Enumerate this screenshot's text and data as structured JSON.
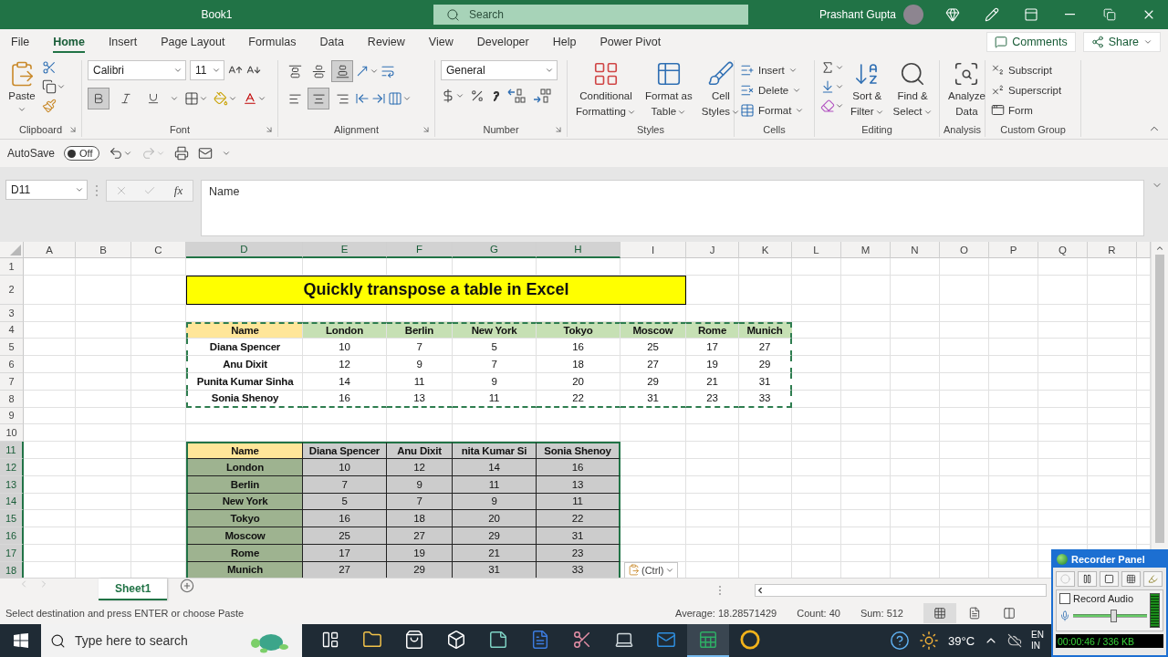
{
  "title_bar": {
    "title": "Book1",
    "search_placeholder": "Search",
    "user_name": "Prashant Gupta"
  },
  "ribbon_tabs": [
    {
      "label": "File",
      "selected": false
    },
    {
      "label": "Home",
      "selected": true
    },
    {
      "label": "Insert",
      "selected": false
    },
    {
      "label": "Page Layout",
      "selected": false
    },
    {
      "label": "Formulas",
      "selected": false
    },
    {
      "label": "Data",
      "selected": false
    },
    {
      "label": "Review",
      "selected": false
    },
    {
      "label": "View",
      "selected": false
    },
    {
      "label": "Developer",
      "selected": false
    },
    {
      "label": "Help",
      "selected": false
    },
    {
      "label": "Power Pivot",
      "selected": false
    }
  ],
  "comments_button": "Comments",
  "share_button": "Share",
  "ribbon_groups": [
    {
      "kind": "clipboard",
      "label": "Clipboard",
      "paste_label": "Paste"
    },
    {
      "kind": "font",
      "label": "Font",
      "font_name": "Calibri",
      "font_size": "11",
      "bold_on": true,
      "italic_on": false,
      "underline_on": false
    },
    {
      "kind": "alignment",
      "label": "Alignment",
      "vertical_buttons": [
        {
          "selected": false
        },
        {
          "selected": false
        },
        {
          "selected": true
        }
      ],
      "horizontal_buttons": [
        {
          "selected": false
        },
        {
          "selected": true
        },
        {
          "selected": false
        }
      ]
    },
    {
      "kind": "number",
      "label": "Number",
      "format": "General"
    },
    {
      "kind": "styles",
      "label": "Styles",
      "buttons": [
        {
          "lines": [
            "Conditional",
            "Formatting"
          ],
          "dropdown": true
        },
        {
          "lines": [
            "Format as",
            "Table"
          ],
          "dropdown": true
        },
        {
          "lines": [
            "Cell",
            "Styles"
          ],
          "dropdown": true
        }
      ]
    },
    {
      "kind": "cells",
      "label": "Cells",
      "buttons": [
        "Insert",
        "Delete",
        "Format"
      ]
    },
    {
      "kind": "editing",
      "label": "Editing",
      "buttons": [
        {
          "lines": [
            "Sort &",
            "Filter"
          ],
          "dropdown": true
        },
        {
          "lines": [
            "Find &",
            "Select"
          ],
          "dropdown": true
        }
      ]
    },
    {
      "kind": "analysis",
      "label": "Analysis",
      "buttons": [
        {
          "lines": [
            "Analyze",
            "Data"
          ],
          "dropdown": false
        }
      ]
    },
    {
      "kind": "custom",
      "label": "Custom Group",
      "buttons": [
        "Subscript",
        "Superscript",
        "Form"
      ]
    }
  ],
  "quick_access": {
    "autosave_label": "AutoSave",
    "autosave_on": false,
    "autosave_state": "Off"
  },
  "formula_bar": {
    "name_box": "D11",
    "function_label": "fx",
    "formula": "Name"
  },
  "sheet": {
    "columns": [
      "A",
      "B",
      "C",
      "D",
      "E",
      "F",
      "G",
      "H",
      "I",
      "J",
      "K",
      "L",
      "M",
      "N",
      "O",
      "P",
      "Q",
      "R"
    ],
    "rows": [
      "1",
      "2",
      "3",
      "4",
      "5",
      "6",
      "7",
      "8",
      "9",
      "10",
      "11",
      "12",
      "13",
      "14",
      "15",
      "16",
      "17",
      "18"
    ],
    "title_cell": {
      "text": "Quickly transpose a table in Excel"
    },
    "tables": [
      {
        "copy_marquee": true,
        "selected": false,
        "header": [
          "Name",
          "London",
          "Berlin",
          "New York",
          "Tokyo",
          "Moscow",
          "Rome",
          "Munich"
        ],
        "rows": [
          [
            "Diana Spencer",
            "10",
            "7",
            "5",
            "16",
            "25",
            "17",
            "27"
          ],
          [
            "Anu Dixit",
            "12",
            "9",
            "7",
            "18",
            "27",
            "19",
            "29"
          ],
          [
            "Punita Kumar Sinha",
            "14",
            "11",
            "9",
            "20",
            "29",
            "21",
            "31"
          ],
          [
            "Sonia Shenoy",
            "16",
            "13",
            "11",
            "22",
            "31",
            "23",
            "33"
          ]
        ]
      },
      {
        "copy_marquee": false,
        "selected": true,
        "header": [
          "Name",
          "Diana Spencer",
          "Anu Dixit",
          "nita Kumar Si",
          "Sonia Shenoy"
        ],
        "rows": [
          [
            "London",
            "10",
            "12",
            "14",
            "16"
          ],
          [
            "Berlin",
            "7",
            "9",
            "11",
            "13"
          ],
          [
            "New York",
            "5",
            "7",
            "9",
            "11"
          ],
          [
            "Tokyo",
            "16",
            "18",
            "20",
            "22"
          ],
          [
            "Moscow",
            "25",
            "27",
            "29",
            "31"
          ],
          [
            "Rome",
            "17",
            "19",
            "21",
            "23"
          ],
          [
            "Munich",
            "27",
            "29",
            "31",
            "33"
          ]
        ],
        "paste_options": "(Ctrl)"
      }
    ]
  },
  "sheet_tabs": [
    {
      "label": "Sheet1",
      "selected": true
    }
  ],
  "status_bar": {
    "message": "Select destination and press ENTER or choose Paste",
    "average": "Average: 18.28571429",
    "count": "Count: 40",
    "sum": "Sum: 512"
  },
  "taskbar": {
    "search_placeholder": "Type here to search",
    "temperature": "39°C",
    "language": [
      "EN",
      "IN"
    ]
  },
  "recorder_panel": {
    "title": "Recorder Panel",
    "record_audio_label": "Record Audio",
    "record_audio_checked": false,
    "volume": {
      "level": 0.55
    },
    "timer": "00:00:46 / 336 KB"
  }
}
